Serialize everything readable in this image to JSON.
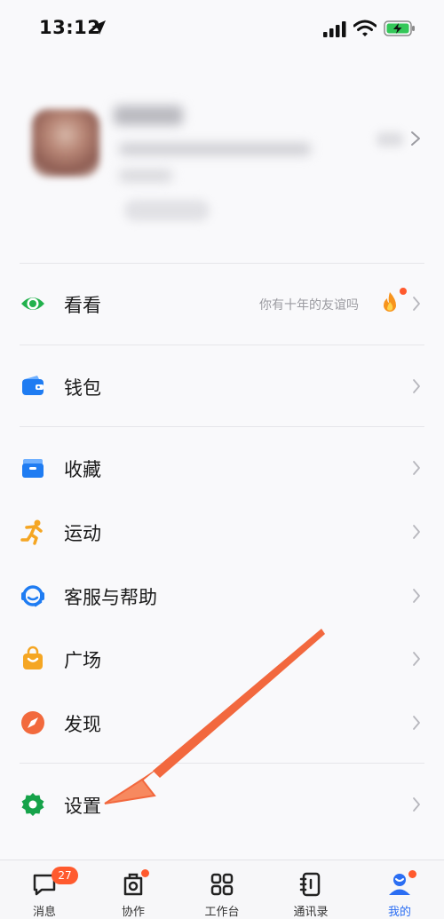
{
  "status_bar": {
    "time": "13:12"
  },
  "profile": {},
  "menu": {
    "kankan": {
      "label": "看看",
      "hint": "你有十年的友谊吗"
    },
    "wallet": {
      "label": "钱包"
    },
    "favorites": {
      "label": "收藏"
    },
    "sports": {
      "label": "运动"
    },
    "support": {
      "label": "客服与帮助"
    },
    "plaza": {
      "label": "广场"
    },
    "discover": {
      "label": "发现"
    },
    "settings": {
      "label": "设置"
    }
  },
  "tabbar": {
    "tabs": [
      {
        "label": "消息",
        "badge": "27"
      },
      {
        "label": "协作"
      },
      {
        "label": "工作台"
      },
      {
        "label": "通讯录"
      },
      {
        "label": "我的"
      }
    ]
  },
  "colors": {
    "accent": "#2b6ef3",
    "badge": "#ff5a2e",
    "kankan": "#22b14c",
    "wallet": "#1f7cf2",
    "sports": "#f5a623",
    "discover": "#f26a3d",
    "settings": "#16a34a",
    "annotation_arrow": "#f2683e"
  }
}
